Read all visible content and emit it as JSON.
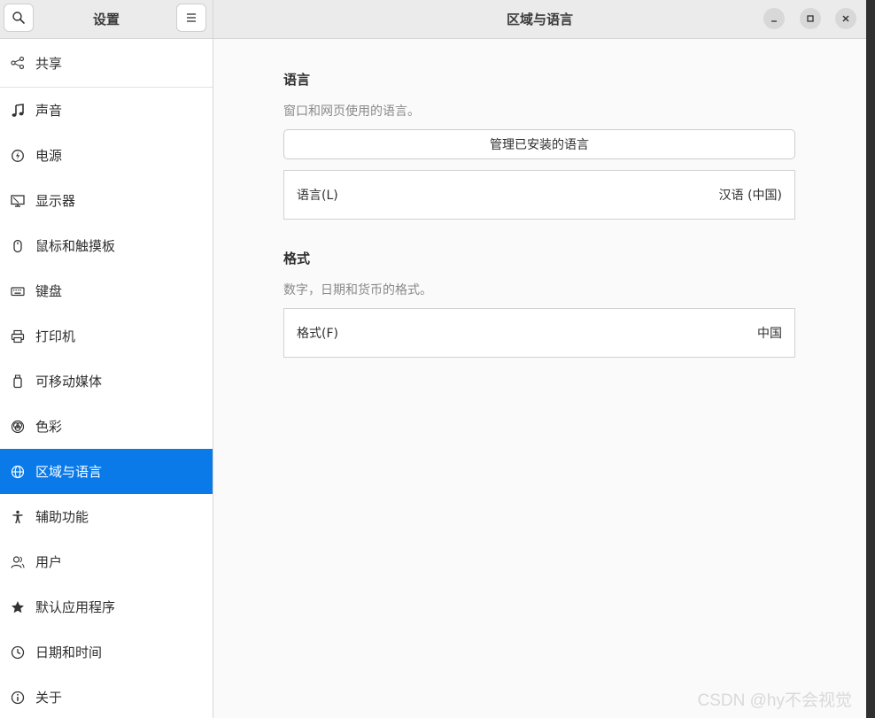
{
  "sidebar": {
    "title": "设置",
    "items": [
      {
        "label": "共享",
        "icon": "share-icon"
      },
      {
        "label": "声音",
        "icon": "music-note-icon"
      },
      {
        "label": "电源",
        "icon": "power-icon"
      },
      {
        "label": "显示器",
        "icon": "display-icon"
      },
      {
        "label": "鼠标和触摸板",
        "icon": "mouse-icon"
      },
      {
        "label": "键盘",
        "icon": "keyboard-icon"
      },
      {
        "label": "打印机",
        "icon": "printer-icon"
      },
      {
        "label": "可移动媒体",
        "icon": "removable-media-icon"
      },
      {
        "label": "色彩",
        "icon": "color-icon"
      },
      {
        "label": "区域与语言",
        "icon": "globe-icon",
        "active": true
      },
      {
        "label": "辅助功能",
        "icon": "accessibility-icon"
      },
      {
        "label": "用户",
        "icon": "users-icon"
      },
      {
        "label": "默认应用程序",
        "icon": "star-icon"
      },
      {
        "label": "日期和时间",
        "icon": "clock-icon"
      },
      {
        "label": "关于",
        "icon": "info-icon"
      }
    ]
  },
  "header": {
    "title": "区域与语言"
  },
  "language_section": {
    "title": "语言",
    "description": "窗口和网页使用的语言。",
    "manage_button": "管理已安装的语言",
    "row_label": "语言(L)",
    "row_value": "汉语 (中国)"
  },
  "format_section": {
    "title": "格式",
    "description": "数字，日期和货币的格式。",
    "row_label": "格式(F)",
    "row_value": "中国"
  },
  "watermark": "CSDN @hy不会视觉",
  "colors": {
    "accent": "#0a7ae8",
    "sidebar_bg": "#ffffff",
    "content_bg": "#fafafa"
  }
}
